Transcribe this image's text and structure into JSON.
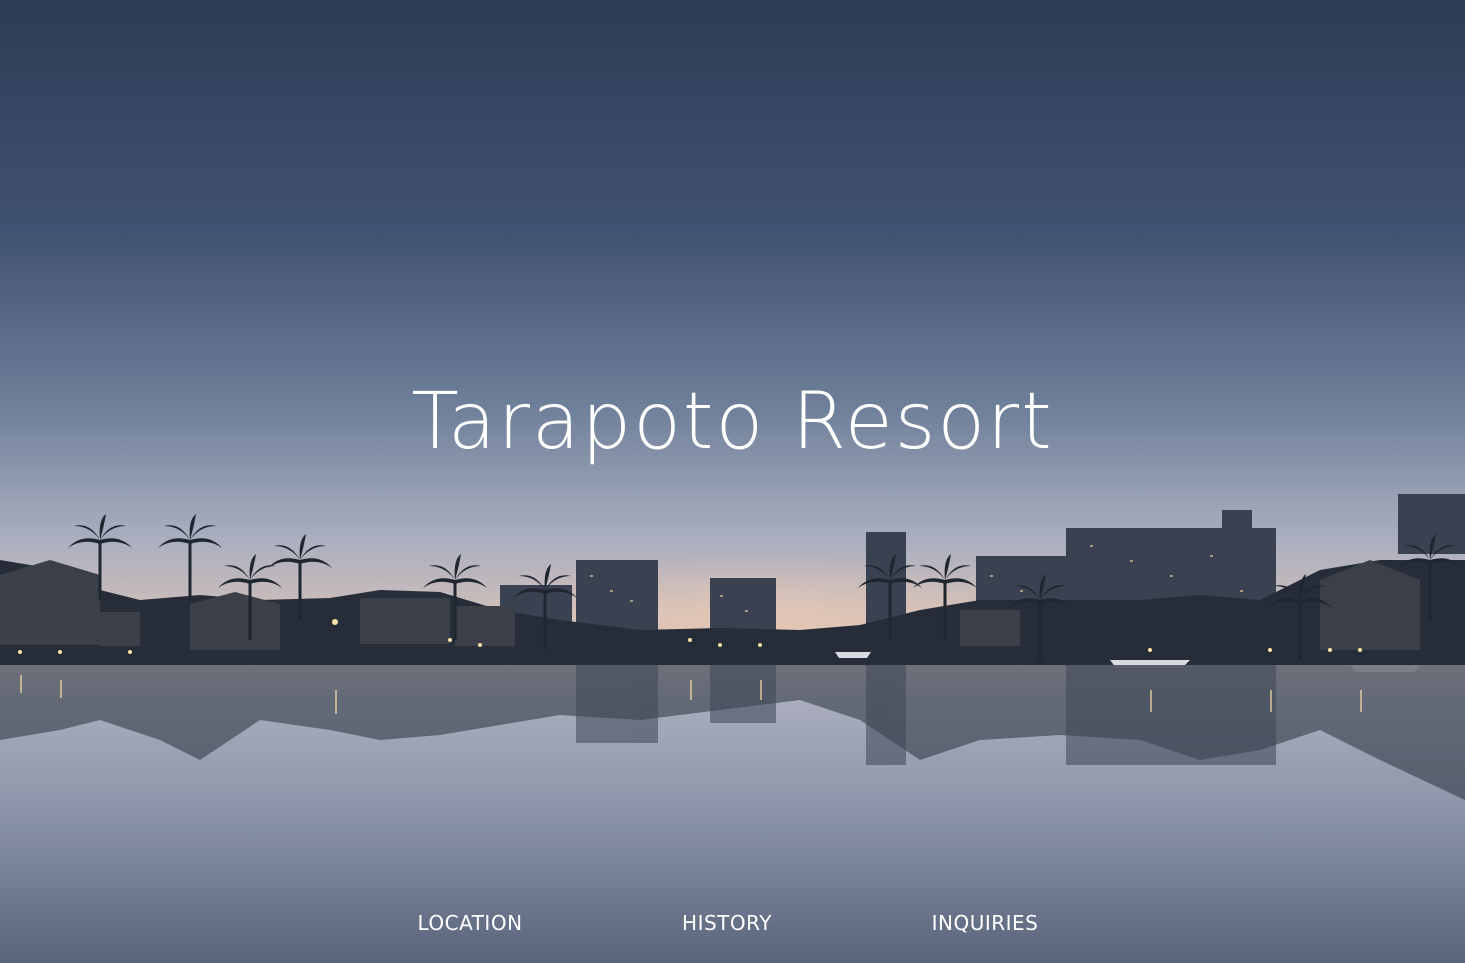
{
  "site": {
    "title": "Tarapoto Resort"
  },
  "nav": {
    "items": [
      {
        "label": "LOCATION"
      },
      {
        "label": "HISTORY"
      },
      {
        "label": "INQUIRIES"
      }
    ]
  },
  "hero": {
    "image": "waterfront-dusk-skyline-photo",
    "colors": {
      "sky_top": "#2f3d57",
      "sky_mid": "#6a7b96",
      "horizon_glow": "#d8c2b6",
      "water": "#8f98ad",
      "silhouette": "#232b36",
      "lights": "#ffe2a8"
    }
  }
}
